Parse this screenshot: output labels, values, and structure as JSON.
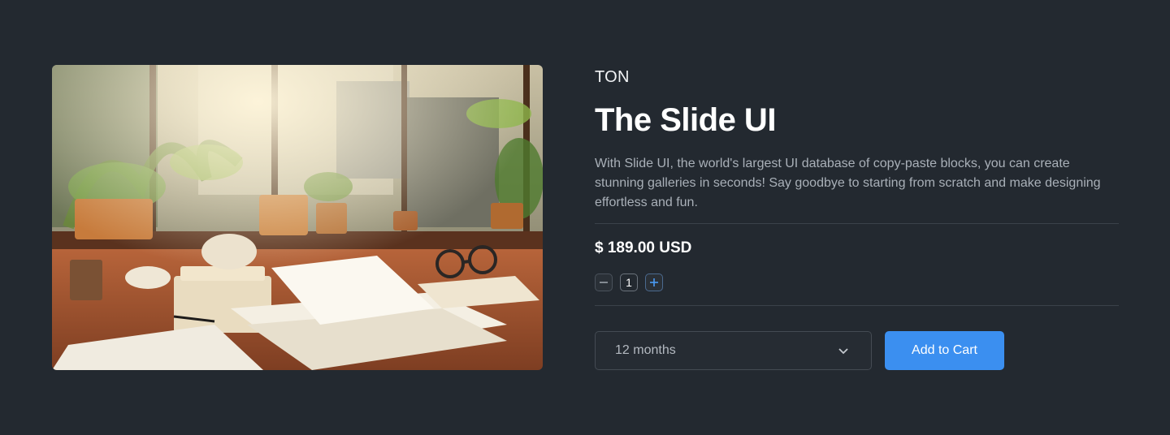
{
  "product": {
    "brand": "TON",
    "title": "The Slide UI",
    "description": "With Slide UI, the world's largest UI database of copy-paste blocks, you can create stunning galleries in seconds! Say goodbye to starting from scratch and make designing effortless and fun.",
    "price": "$ 189.00 USD",
    "quantity": "1"
  },
  "plan_select": {
    "selected": "12 months"
  },
  "actions": {
    "add_to_cart": "Add to Cart"
  },
  "colors": {
    "background": "#232930",
    "accent": "#3b8ff0",
    "divider": "#3b424a",
    "text_muted": "#a9b0b8"
  },
  "icons": {
    "minus": "minus-icon",
    "plus": "plus-icon",
    "select_arrow": "chevron-down-icon"
  }
}
